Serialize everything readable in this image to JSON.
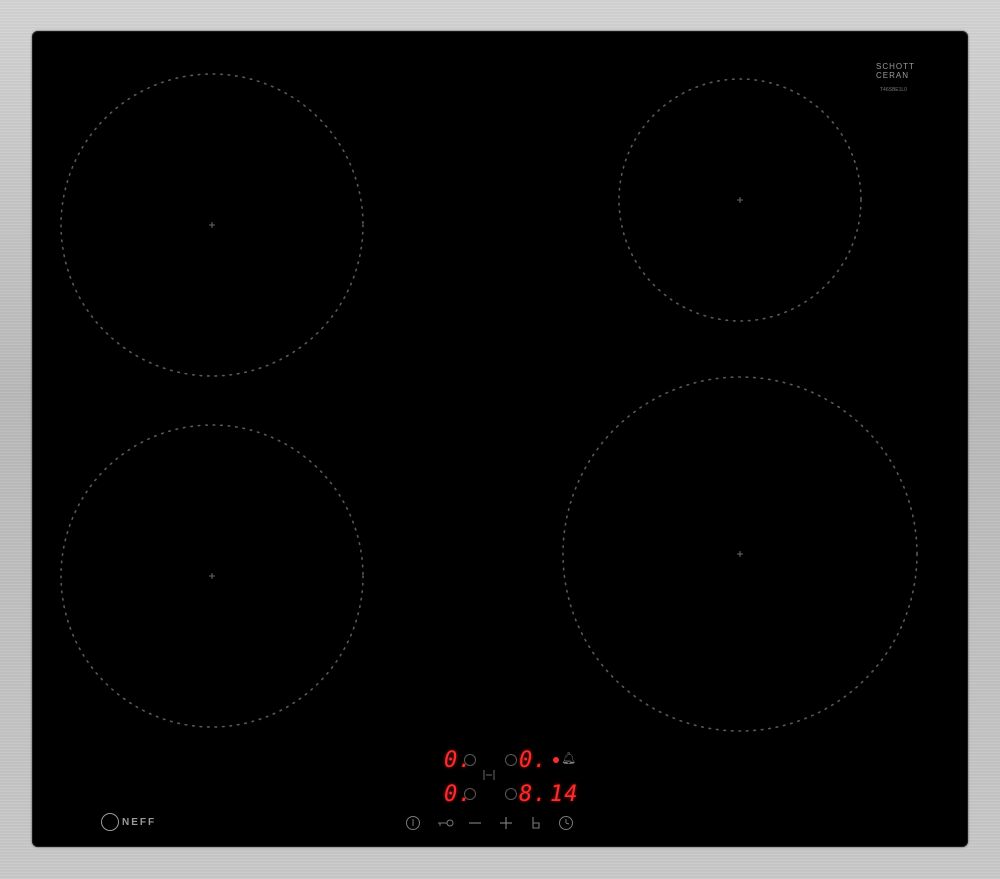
{
  "brand": {
    "name": "NEFF"
  },
  "glass_brand": {
    "line1": "SCHOTT",
    "line2": "CERAN"
  },
  "model": {
    "code": "T46SBE1L0"
  },
  "display": {
    "zone_front_left": "0.",
    "zone_rear_left": "0.",
    "zone_rear_right": "0.",
    "zone_front_right": "8.",
    "timer": "14"
  },
  "controls": [
    {
      "name": "power",
      "icon": "power-icon"
    },
    {
      "name": "key",
      "icon": "key-icon"
    },
    {
      "name": "minus",
      "icon": "minus-icon"
    },
    {
      "name": "plus",
      "icon": "plus-icon"
    },
    {
      "name": "boost",
      "icon": "boost-icon"
    },
    {
      "name": "timer",
      "icon": "timer-icon"
    }
  ],
  "colors": {
    "display_red": "#ff2a2a",
    "glass": "#000000",
    "frame": "#bdbdbd"
  }
}
